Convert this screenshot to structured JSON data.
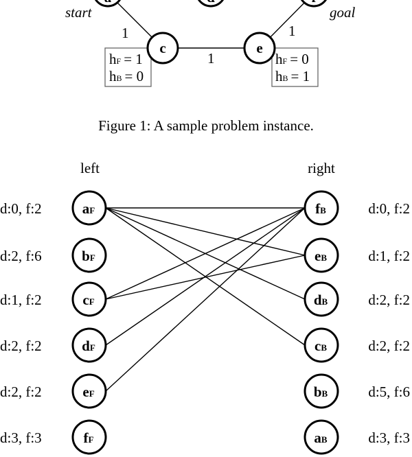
{
  "figure1": {
    "nodes": [
      {
        "id": "a",
        "label": "a"
      },
      {
        "id": "d",
        "label": "d"
      },
      {
        "id": "f",
        "label": "f"
      },
      {
        "id": "c",
        "label": "c"
      },
      {
        "id": "e",
        "label": "e"
      }
    ],
    "start_label": "start",
    "goal_label": "goal",
    "edges": [
      {
        "from": "a",
        "to": "c",
        "weight": "1"
      },
      {
        "from": "c",
        "to": "e",
        "weight": "1"
      },
      {
        "from": "e",
        "to": "f",
        "weight": "1"
      }
    ],
    "heuristics": {
      "c": {
        "hF": "h",
        "hF_sub": "F",
        "hF_val": "= 1",
        "hB": "h",
        "hB_sub": "B",
        "hB_val": "= 0"
      },
      "e": {
        "hF": "h",
        "hF_sub": "F",
        "hF_val": "= 0",
        "hB": "h",
        "hB_sub": "B",
        "hB_val": "= 1"
      }
    },
    "caption": "Figure 1: A sample problem instance."
  },
  "figure2": {
    "left_title": "left",
    "right_title": "right",
    "left": [
      {
        "id": "aF",
        "letter": "a",
        "sub": "F",
        "info": "d:0, f:2"
      },
      {
        "id": "bF",
        "letter": "b",
        "sub": "F",
        "info": "d:2, f:6"
      },
      {
        "id": "cF",
        "letter": "c",
        "sub": "F",
        "info": "d:1, f:2"
      },
      {
        "id": "dF",
        "letter": "d",
        "sub": "F",
        "info": "d:2, f:2"
      },
      {
        "id": "eF",
        "letter": "e",
        "sub": "F",
        "info": "d:2, f:2"
      },
      {
        "id": "fF",
        "letter": "f",
        "sub": "F",
        "info": "d:3, f:3"
      }
    ],
    "right": [
      {
        "id": "fB",
        "letter": "f",
        "sub": "B",
        "info": "d:0, f:2"
      },
      {
        "id": "eB",
        "letter": "e",
        "sub": "B",
        "info": "d:1, f:2"
      },
      {
        "id": "dB",
        "letter": "d",
        "sub": "B",
        "info": "d:2, f:2"
      },
      {
        "id": "cB",
        "letter": "c",
        "sub": "B",
        "info": "d:2, f:2"
      },
      {
        "id": "bB",
        "letter": "b",
        "sub": "B",
        "info": "d:5, f:6"
      },
      {
        "id": "aB",
        "letter": "a",
        "sub": "B",
        "info": "d:3, f:3"
      }
    ],
    "edges": [
      [
        "aF",
        "fB"
      ],
      [
        "aF",
        "eB"
      ],
      [
        "aF",
        "dB"
      ],
      [
        "aF",
        "cB"
      ],
      [
        "cF",
        "fB"
      ],
      [
        "cF",
        "eB"
      ],
      [
        "dF",
        "fB"
      ],
      [
        "eF",
        "fB"
      ]
    ]
  }
}
